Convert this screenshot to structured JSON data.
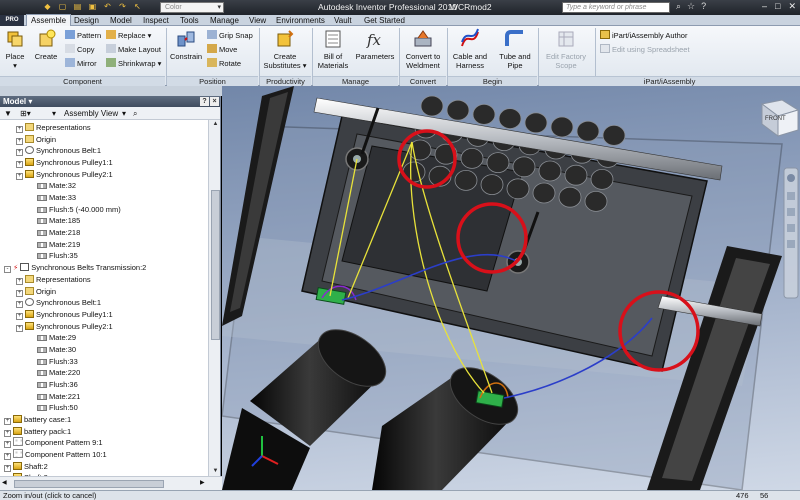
{
  "titlebar": {
    "pro_badge": "PRO",
    "color_combo": "Color",
    "app_title": "Autodesk Inventor Professional 2010",
    "doc_title": "WCRmod2",
    "search_placeholder": "Type a keyword or phrase"
  },
  "tabs": [
    "Assemble",
    "Design",
    "Model",
    "Inspect",
    "Tools",
    "Manage",
    "View",
    "Environments",
    "Vault",
    "Get Started"
  ],
  "ribbon": {
    "component": {
      "label": "Component",
      "place": "Place",
      "create": "Create",
      "pattern": "Pattern",
      "copy": "Copy",
      "mirror": "Mirror",
      "replace": "Replace",
      "make_layout": "Make Layout",
      "shrinkwrap": "Shrinkwrap"
    },
    "position": {
      "label": "Position",
      "constrain": "Constrain",
      "grip_snap": "Grip Snap",
      "move": "Move",
      "rotate": "Rotate"
    },
    "productivity": {
      "label": "Productivity",
      "create_substitutes_1": "Create",
      "create_substitutes_2": "Substitutes"
    },
    "manage": {
      "label": "Manage",
      "bom_1": "Bill of",
      "bom_2": "Materials",
      "parameters": "Parameters"
    },
    "convert": {
      "label": "Convert",
      "convert_1": "Convert to",
      "convert_2": "Weldment"
    },
    "begin": {
      "label": "Begin",
      "cable_1": "Cable and",
      "cable_2": "Harness",
      "tube_1": "Tube and",
      "tube_2": "Pipe"
    },
    "edit_factory": {
      "edit_1": "Edit Factory",
      "edit_2": "Scope"
    },
    "ipart": {
      "label": "iPart/iAssembly",
      "author": "iPart/iAssembly Author",
      "spreadsheet": "Edit using Spreadsheet"
    }
  },
  "browser": {
    "title": "Model ▾",
    "view_mode": "Assembly View",
    "tree": [
      {
        "indent": 1,
        "exp": "+",
        "icon": "folder",
        "label": "Representations"
      },
      {
        "indent": 1,
        "exp": "+",
        "icon": "origin",
        "label": "Origin"
      },
      {
        "indent": 1,
        "exp": "+",
        "icon": "belt",
        "label": "Synchronous Belt:1"
      },
      {
        "indent": 1,
        "exp": "+",
        "icon": "part",
        "label": "Synchronous Pulley1:1"
      },
      {
        "indent": 1,
        "exp": "+",
        "icon": "part",
        "label": "Synchronous Pulley2:1"
      },
      {
        "indent": 2,
        "exp": "",
        "icon": "mate",
        "label": "Mate:32"
      },
      {
        "indent": 2,
        "exp": "",
        "icon": "mate",
        "label": "Mate:33"
      },
      {
        "indent": 2,
        "exp": "",
        "icon": "mate",
        "label": "Flush:5 (-40.000 mm)"
      },
      {
        "indent": 2,
        "exp": "",
        "icon": "mate",
        "label": "Mate:185"
      },
      {
        "indent": 2,
        "exp": "",
        "icon": "mate",
        "label": "Mate:218"
      },
      {
        "indent": 2,
        "exp": "",
        "icon": "mate",
        "label": "Mate:219"
      },
      {
        "indent": 2,
        "exp": "",
        "icon": "mate",
        "label": "Flush:35"
      },
      {
        "indent": 0,
        "exp": "-",
        "icon": "trans",
        "label": "Synchronous Belts Transmission:2",
        "error": true
      },
      {
        "indent": 1,
        "exp": "+",
        "icon": "folder",
        "label": "Representations"
      },
      {
        "indent": 1,
        "exp": "+",
        "icon": "origin",
        "label": "Origin"
      },
      {
        "indent": 1,
        "exp": "+",
        "icon": "belt",
        "label": "Synchronous Belt:1"
      },
      {
        "indent": 1,
        "exp": "+",
        "icon": "part",
        "label": "Synchronous Pulley1:1"
      },
      {
        "indent": 1,
        "exp": "+",
        "icon": "part",
        "label": "Synchronous Pulley2:1"
      },
      {
        "indent": 2,
        "exp": "",
        "icon": "mate",
        "label": "Mate:29"
      },
      {
        "indent": 2,
        "exp": "",
        "icon": "mate",
        "label": "Mate:30"
      },
      {
        "indent": 2,
        "exp": "",
        "icon": "mate",
        "label": "Flush:33"
      },
      {
        "indent": 2,
        "exp": "",
        "icon": "mate",
        "label": "Mate:220"
      },
      {
        "indent": 2,
        "exp": "",
        "icon": "mate",
        "label": "Flush:36"
      },
      {
        "indent": 2,
        "exp": "",
        "icon": "mate",
        "label": "Mate:221"
      },
      {
        "indent": 2,
        "exp": "",
        "icon": "mate",
        "label": "Flush:50"
      },
      {
        "indent": 0,
        "exp": "+",
        "icon": "part",
        "label": "battery case:1"
      },
      {
        "indent": 0,
        "exp": "+",
        "icon": "part",
        "label": "battery pack:1"
      },
      {
        "indent": 0,
        "exp": "+",
        "icon": "pattern",
        "label": "Component Pattern 9:1"
      },
      {
        "indent": 0,
        "exp": "+",
        "icon": "pattern",
        "label": "Component Pattern 10:1"
      },
      {
        "indent": 0,
        "exp": "+",
        "icon": "part",
        "label": "Shaft:2"
      },
      {
        "indent": 0,
        "exp": "+",
        "icon": "part",
        "label": "Shaft:3"
      }
    ]
  },
  "viewcube": {
    "label": "FRONT"
  },
  "status": {
    "text": "Zoom in/out (click to cancel)",
    "value_a": "476",
    "value_b": "56"
  },
  "colors": {
    "highlight_circle": "#d8101a",
    "belt_yellow": "#e8e23a",
    "belt_blue": "#2b3ec9",
    "ribbon_bg": "#e4eaf1",
    "viewport_top": "#7287a9",
    "viewport_bottom": "#cfd8e6"
  }
}
